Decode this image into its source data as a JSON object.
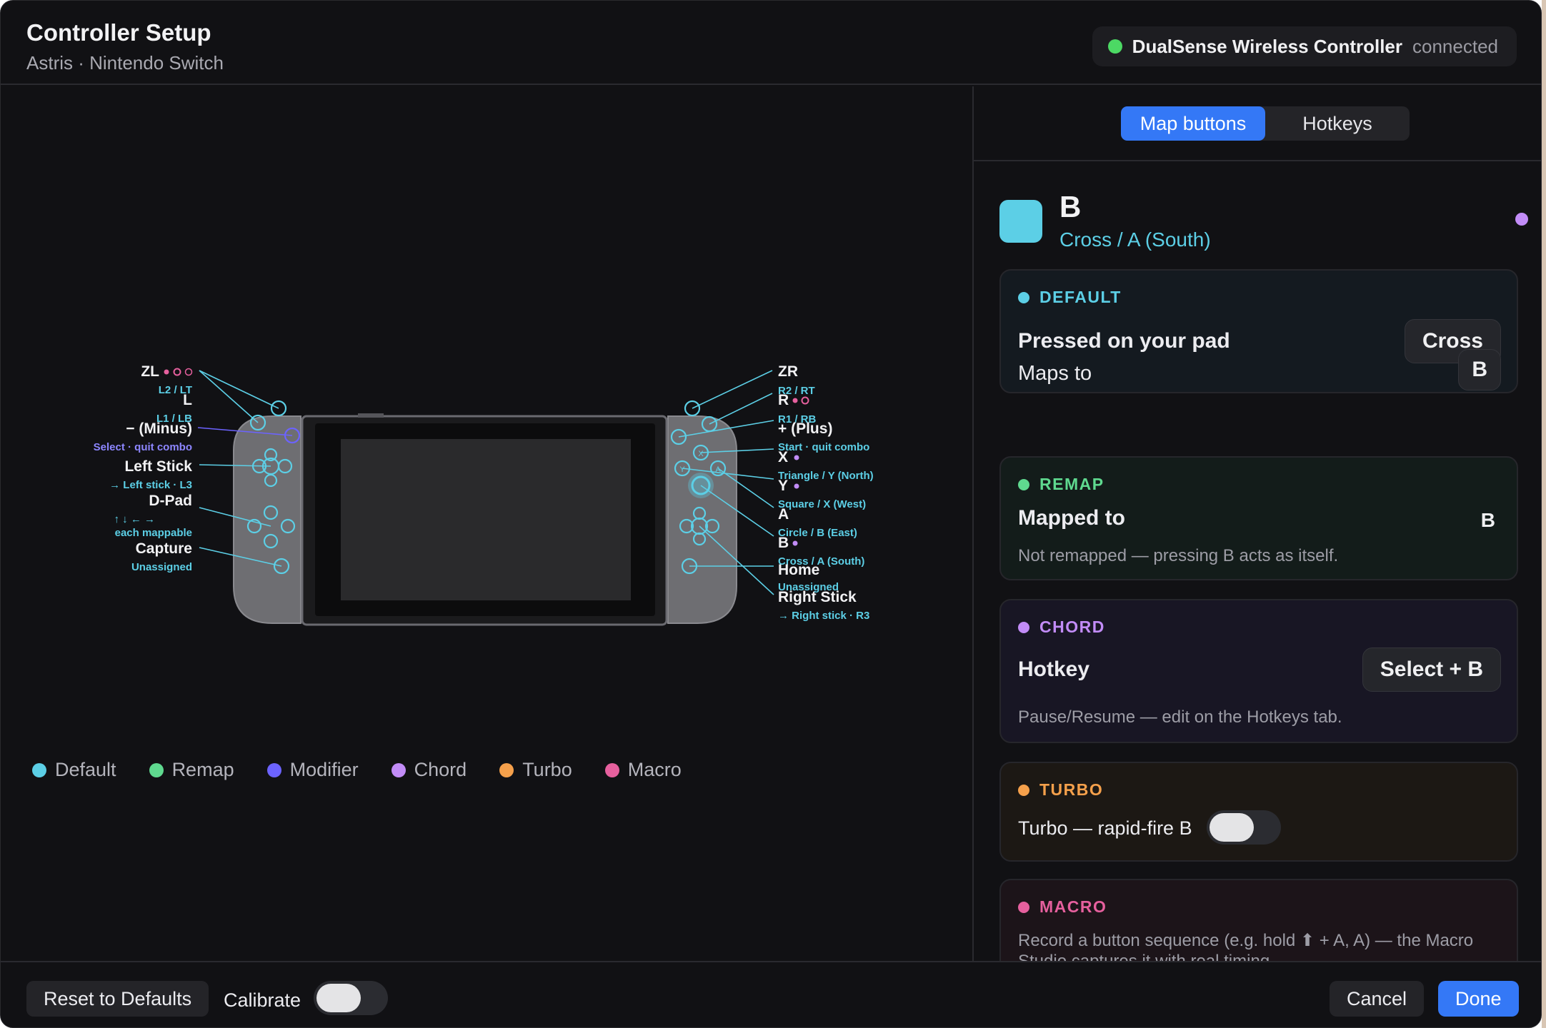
{
  "header": {
    "title": "Controller Setup",
    "subtitle": "Astris · Nintendo Switch",
    "device_name": "DualSense Wireless Controller",
    "device_status": "connected",
    "status_color": "#4cd964"
  },
  "diagram": {
    "left_labels": [
      {
        "name": "ZL",
        "sub": "L2 / LT"
      },
      {
        "name": "L",
        "sub": "L1 / LB"
      },
      {
        "name": "− (Minus)",
        "sub": "Select · quit combo"
      },
      {
        "name": "Left Stick",
        "sub": "→ Left stick · L3"
      },
      {
        "name": "D-Pad",
        "sub": "↑ ↓ ← →",
        "sub2": "each mappable"
      },
      {
        "name": "Capture",
        "sub": "Unassigned"
      }
    ],
    "right_labels": [
      {
        "name": "ZR",
        "sub": "R2 / RT"
      },
      {
        "name": "R",
        "sub": "R1 / RB"
      },
      {
        "name": "+ (Plus)",
        "sub": "Start · quit combo"
      },
      {
        "name": "X",
        "sub": "Triangle / Y (North)"
      },
      {
        "name": "Y",
        "sub": "Square / X (West)"
      },
      {
        "name": "A",
        "sub": "Circle / B (East)"
      },
      {
        "name": "B",
        "sub": "Cross / A (South)"
      },
      {
        "name": "Home",
        "sub": "Unassigned"
      },
      {
        "name": "Right Stick",
        "sub": "→ Right stick · R3"
      }
    ]
  },
  "legend": [
    {
      "label": "Default",
      "color": "#5ccfe6"
    },
    {
      "label": "Remap",
      "color": "#5fd98f"
    },
    {
      "label": "Modifier",
      "color": "#6c63ff"
    },
    {
      "label": "Chord",
      "color": "#c28cf7"
    },
    {
      "label": "Turbo",
      "color": "#f5a04b"
    },
    {
      "label": "Macro",
      "color": "#e6609e"
    }
  ],
  "tabs": {
    "map": "Map buttons",
    "hotkeys": "Hotkeys",
    "active": "map"
  },
  "selected": {
    "letter": "B",
    "sub": "Cross / A (South)",
    "swatch_color": "#5ccfe6"
  },
  "cards": {
    "default": {
      "title": "DEFAULT",
      "color": "#5ccfe6",
      "pressed_label": "Pressed on your pad",
      "pressed_value": "Cross",
      "maps_label": "Maps to",
      "maps_value": "B"
    },
    "remap": {
      "title": "REMAP",
      "color": "#5fd98f",
      "label": "Mapped to",
      "value": "B",
      "note": "Not remapped — pressing B acts as itself."
    },
    "chord": {
      "title": "CHORD",
      "color": "#c28cf7",
      "label": "Hotkey",
      "value": "Select + B",
      "note": "Pause/Resume — edit on the Hotkeys tab."
    },
    "turbo": {
      "title": "TURBO",
      "color": "#f5a04b",
      "label": "Turbo — rapid-fire B",
      "enabled": false
    },
    "macro": {
      "title": "MACRO",
      "color": "#e6609e",
      "note_line1": "Record a button sequence (e.g. hold ⬆ + A, A) — the Macro",
      "note_line2": "Studio captures it with real timing"
    }
  },
  "footer": {
    "reset": "Reset to Defaults",
    "calibrate": "Calibrate",
    "calibrate_enabled": false,
    "cancel": "Cancel",
    "done": "Done"
  }
}
